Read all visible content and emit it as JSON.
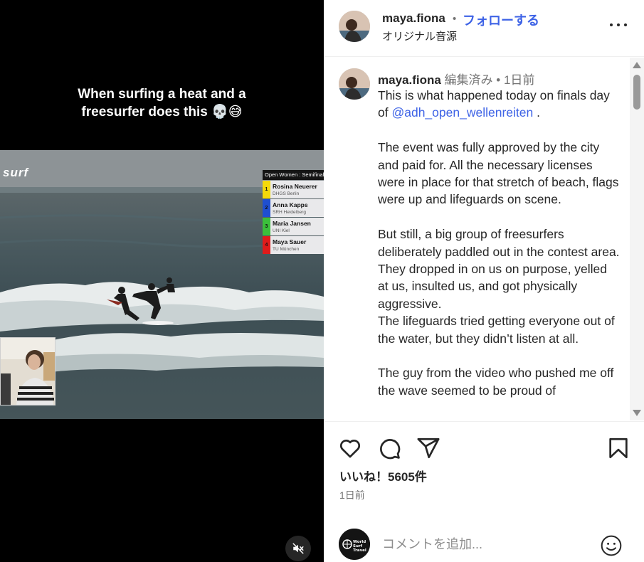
{
  "video": {
    "caption_line1": "When surfing a heat and a",
    "caption_line2": "freesurfer does this 💀😅",
    "brand": "surf",
    "scoreboard": {
      "title": "Open Women : Semifinal",
      "rows": [
        {
          "rank": "1",
          "name": "Rosina Neuerer",
          "uni": "DHGS Berlin",
          "color": "#f5d90a"
        },
        {
          "rank": "2",
          "name": "Anna Kapps",
          "uni": "SRH Heidelberg",
          "color": "#1f4fd1"
        },
        {
          "rank": "3",
          "name": "Maria Jansen",
          "uni": "UNI Kiel",
          "color": "#3bbf3b"
        },
        {
          "rank": "4",
          "name": "Maya Sauer",
          "uni": "TU München",
          "color": "#e01b1b"
        }
      ]
    },
    "mute_icon": "muted-speaker-icon"
  },
  "header": {
    "username": "maya.fiona",
    "separator": "•",
    "follow_label": "フォローする",
    "audio_label": "オリジナル音源",
    "more_icon": "more-options-icon"
  },
  "comment": {
    "username": "maya.fiona",
    "edited": "編集済み",
    "separator": "•",
    "time": "1日前",
    "mention": "@adh_open_wellenreiten",
    "p1_before": "This is what happened today on finals day of ",
    "p1_after": " .",
    "p2": "The event was fully approved by the city and paid for. All the necessary licenses were in place for that stretch of beach, flags were up and lifeguards on scene.",
    "p3": "But still, a big group of freesurfers deliberately paddled out in the contest area. They dropped in on us on purpose, yelled at us, insulted us, and got physically aggressive.",
    "p4": "The lifeguards tried getting everyone out of the water, but they didn’t listen at all.",
    "p5": "The guy from the video who pushed me off the wave seemed to be proud of"
  },
  "actions": {
    "icons": [
      "heart-icon",
      "comment-icon",
      "share-icon",
      "bookmark-icon"
    ],
    "likes": "いいね！5605件",
    "date": "1日前"
  },
  "comment_bar": {
    "placeholder": "コメントを追加...",
    "avatar_text": "World Surf Travel",
    "emoji_icon": "emoji-icon"
  },
  "colors": {
    "link_blue": "#3e63e6",
    "text": "#262626",
    "muted": "#737373"
  }
}
